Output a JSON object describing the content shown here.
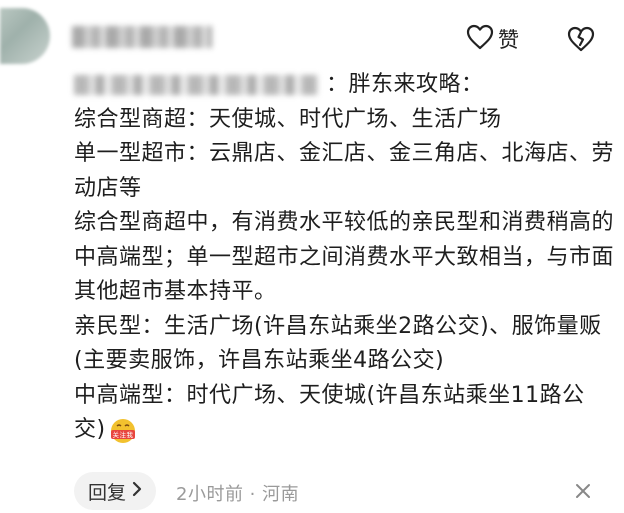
{
  "comment": {
    "like_label": "赞",
    "mention_suffix": "：胖东来攻略：",
    "lines": [
      "综合型商超：天使城、时代广场、生活广场",
      "单一型超市：云鼎店、金汇店、金三角店、北海店、劳动店等",
      "综合型商超中，有消费水平较低的亲民型和消费稍高的中高端型；单一型超市之间消费水平大致相当，与市面其他超市基本持平。",
      "亲民型：生活广场(许昌东站乘坐2路公交)、服饰量贩(主要卖服饰，许昌东站乘坐4路公交)",
      "中高端型：时代广场、天使城(许昌东站乘坐11路公交)"
    ],
    "sticker_text": "关注我"
  },
  "footer": {
    "reply_label": "回复",
    "meta": "2小时前 · 河南"
  },
  "icons": {
    "like": "heart-outline-icon",
    "dislike": "broken-heart-icon",
    "reply_arrow": "chevron-right-icon",
    "close": "close-icon"
  },
  "colors": {
    "text": "#1e1e1e",
    "meta": "#9a9a9a",
    "reply_bg": "#f2f2f2",
    "sticker": "#f2c12e"
  }
}
